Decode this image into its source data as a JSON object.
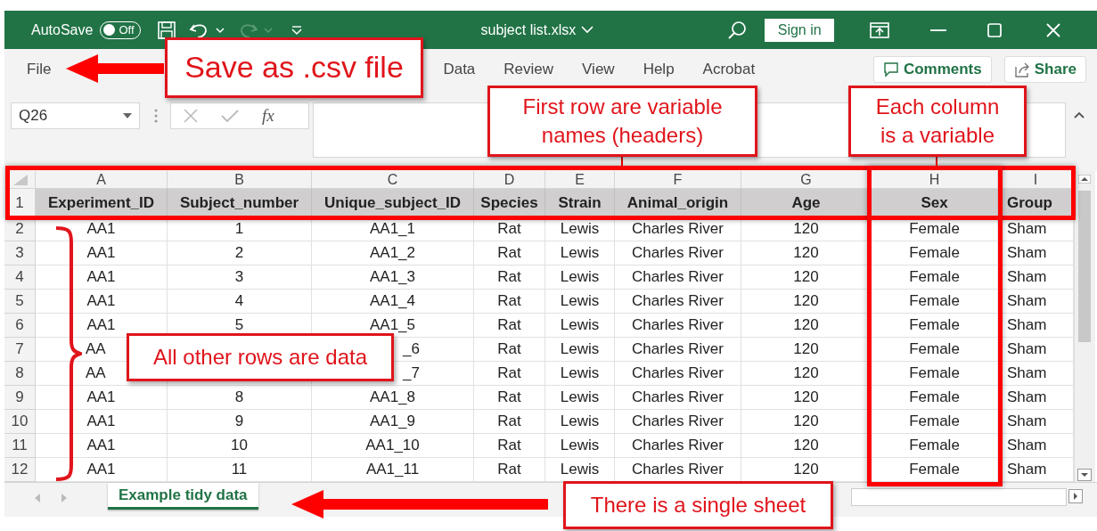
{
  "title_bar": {
    "autosave_label": "AutoSave",
    "autosave_toggle": {
      "label": "Off",
      "on": false
    },
    "file_name": "subject list.xlsx",
    "sign_in": "Sign in"
  },
  "ribbon_tabs": [
    {
      "label": "File"
    },
    {
      "label": "Data"
    },
    {
      "label": "Review"
    },
    {
      "label": "View"
    },
    {
      "label": "Help"
    },
    {
      "label": "Acrobat"
    }
  ],
  "ribbon_buttons": [
    {
      "label": "Comments",
      "kind": "comments"
    },
    {
      "label": "Share",
      "kind": "share"
    }
  ],
  "formula_bar": {
    "name_box": "Q26",
    "function_label": "fx"
  },
  "grid": {
    "column_letters": [
      "A",
      "B",
      "C",
      "D",
      "E",
      "F",
      "G",
      "H",
      "I"
    ],
    "header_row_number": "1",
    "headers": [
      "Experiment_ID",
      "Subject_number",
      "Unique_subject_ID",
      "Species",
      "Strain",
      "Animal_origin",
      "Age",
      "Sex",
      "Group"
    ],
    "rows": [
      {
        "number": "2",
        "cells": [
          "AA1",
          "1",
          "AA1_1",
          "Rat",
          "Lewis",
          "Charles River",
          "120",
          "Female",
          "Sham"
        ]
      },
      {
        "number": "3",
        "cells": [
          "AA1",
          "2",
          "AA1_2",
          "Rat",
          "Lewis",
          "Charles River",
          "120",
          "Female",
          "Sham"
        ]
      },
      {
        "number": "4",
        "cells": [
          "AA1",
          "3",
          "AA1_3",
          "Rat",
          "Lewis",
          "Charles River",
          "120",
          "Female",
          "Sham"
        ]
      },
      {
        "number": "5",
        "cells": [
          "AA1",
          "4",
          "AA1_4",
          "Rat",
          "Lewis",
          "Charles River",
          "120",
          "Female",
          "Sham"
        ]
      },
      {
        "number": "6",
        "cells": [
          "AA1",
          "5",
          "AA1_5",
          "Rat",
          "Lewis",
          "Charles River",
          "120",
          "Female",
          "Sham"
        ]
      },
      {
        "number": "7",
        "cells": [
          "AA",
          "",
          "_6",
          "Rat",
          "Lewis",
          "Charles River",
          "120",
          "Female",
          "Sham"
        ]
      },
      {
        "number": "8",
        "cells": [
          "AA",
          "",
          "_7",
          "Rat",
          "Lewis",
          "Charles River",
          "120",
          "Female",
          "Sham"
        ]
      },
      {
        "number": "9",
        "cells": [
          "AA1",
          "8",
          "AA1_8",
          "Rat",
          "Lewis",
          "Charles River",
          "120",
          "Female",
          "Sham"
        ]
      },
      {
        "number": "10",
        "cells": [
          "AA1",
          "9",
          "AA1_9",
          "Rat",
          "Lewis",
          "Charles River",
          "120",
          "Female",
          "Sham"
        ]
      },
      {
        "number": "11",
        "cells": [
          "AA1",
          "10",
          "AA1_10",
          "Rat",
          "Lewis",
          "Charles River",
          "120",
          "Female",
          "Sham"
        ]
      },
      {
        "number": "12",
        "cells": [
          "AA1",
          "11",
          "AA1_11",
          "Rat",
          "Lewis",
          "Charles River",
          "120",
          "Female",
          "Sham"
        ]
      }
    ]
  },
  "sheet_tabs": [
    {
      "label": "Example tidy data",
      "selected": true
    }
  ],
  "annotations": [
    {
      "kind": "callout",
      "text": "Save as .csv file"
    },
    {
      "kind": "callout",
      "text": "First row are variable names (headers)"
    },
    {
      "kind": "callout",
      "text": "Each column is a variable"
    },
    {
      "kind": "callout",
      "text": "All other rows are data"
    },
    {
      "kind": "callout",
      "text": "There is a single sheet"
    }
  ]
}
